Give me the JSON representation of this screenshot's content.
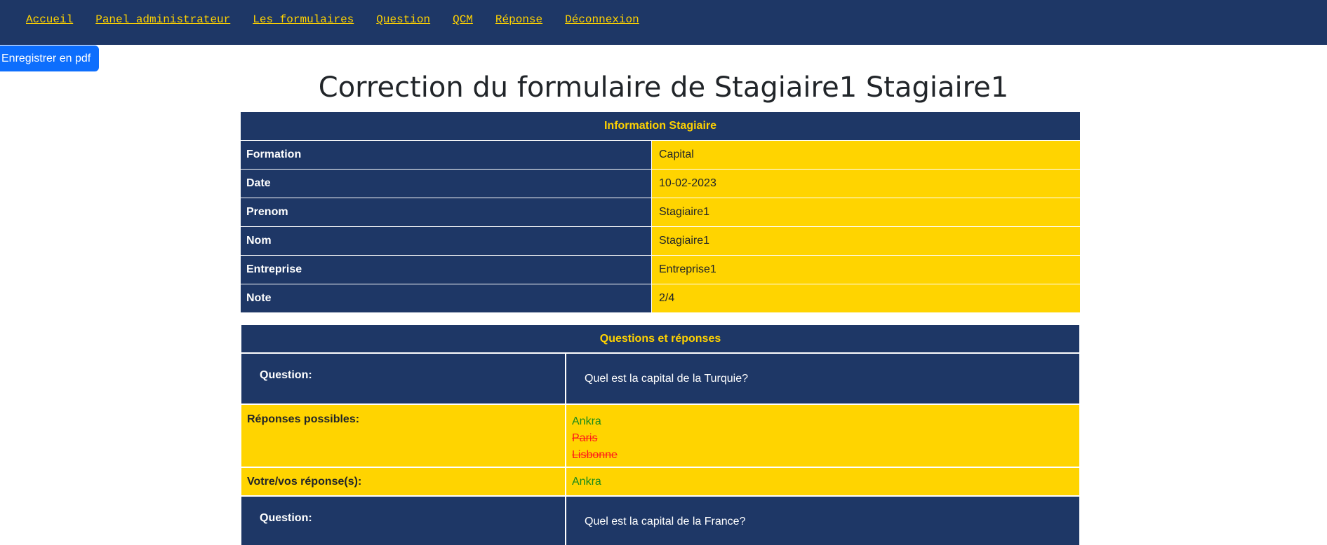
{
  "nav": {
    "items": [
      "Accueil",
      "Panel administrateur",
      "Les formulaires",
      "Question",
      "QCM",
      "Réponse",
      "Déconnexion"
    ]
  },
  "pdf_button": "Enregistrer en pdf",
  "page_title": "Correction du formulaire de Stagiaire1 Stagiaire1",
  "info": {
    "header": "Information Stagiaire",
    "rows": [
      {
        "label": "Formation",
        "value": "Capital"
      },
      {
        "label": "Date",
        "value": "10-02-2023"
      },
      {
        "label": "Prenom",
        "value": "Stagiaire1"
      },
      {
        "label": "Nom",
        "value": "Stagiaire1"
      },
      {
        "label": "Entreprise",
        "value": "Entreprise1"
      },
      {
        "label": "Note",
        "value": "2/4"
      }
    ]
  },
  "qa": {
    "header": "Questions et réponses",
    "question_label": "Question:",
    "possible_label": "Réponses possibles:",
    "your_answer_label": "Votre/vos réponse(s):",
    "items": [
      {
        "question": "Quel est la capital de la Turquie?",
        "answers": [
          {
            "text": "Ankra",
            "status": "correct"
          },
          {
            "text": "Paris",
            "status": "wrong"
          },
          {
            "text": "Lisbonne",
            "status": "wrong"
          }
        ],
        "given": "Ankra"
      },
      {
        "question": "Quel est la capital de la France?"
      }
    ]
  },
  "colors": {
    "navy": "#1e3766",
    "yellow": "#ffd400",
    "link_yellow": "#ffd200",
    "correct": "#1a8a1a",
    "wrong": "#ff1a1a",
    "button_blue": "#0d6efd"
  }
}
